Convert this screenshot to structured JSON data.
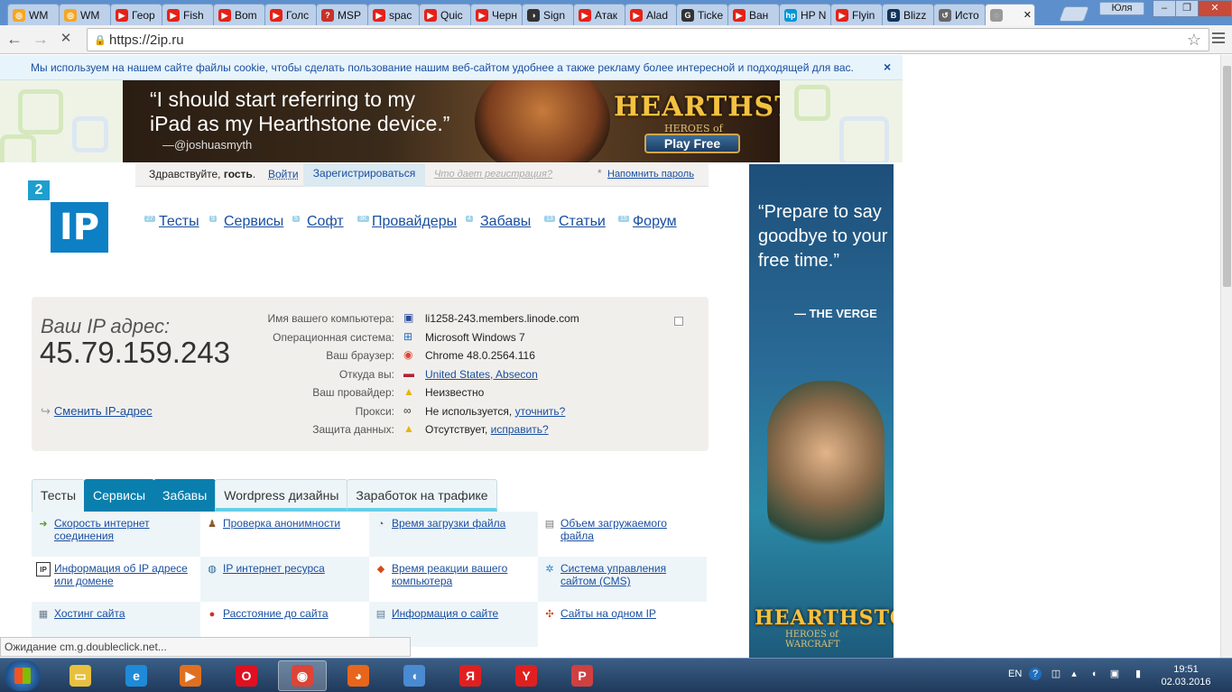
{
  "browser": {
    "tabs": [
      {
        "title": "WM",
        "color": "#f6a623",
        "glyph": "◎"
      },
      {
        "title": "WM",
        "color": "#f6a623",
        "glyph": "◎"
      },
      {
        "title": "Геор",
        "color": "#e62117",
        "glyph": "▶"
      },
      {
        "title": "Fish",
        "color": "#e62117",
        "glyph": "▶"
      },
      {
        "title": "Bom",
        "color": "#e62117",
        "glyph": "▶"
      },
      {
        "title": "Голс",
        "color": "#e62117",
        "glyph": "▶"
      },
      {
        "title": "MSP",
        "color": "#c8302a",
        "glyph": "?"
      },
      {
        "title": "spac",
        "color": "#e62117",
        "glyph": "▶"
      },
      {
        "title": "Quic",
        "color": "#e62117",
        "glyph": "▶"
      },
      {
        "title": "Черн",
        "color": "#e62117",
        "glyph": "▶"
      },
      {
        "title": "Sign",
        "color": "#333333",
        "glyph": "◑"
      },
      {
        "title": "Атак",
        "color": "#e62117",
        "glyph": "▶"
      },
      {
        "title": "Alad",
        "color": "#e62117",
        "glyph": "▶"
      },
      {
        "title": "Ticke",
        "color": "#333333",
        "glyph": "G"
      },
      {
        "title": "Ван",
        "color": "#e62117",
        "glyph": "▶"
      },
      {
        "title": "HP N",
        "color": "#0096d6",
        "glyph": "hp"
      },
      {
        "title": "Flyin",
        "color": "#e62117",
        "glyph": "▶"
      },
      {
        "title": "Blizz",
        "color": "#12345a",
        "glyph": "B"
      },
      {
        "title": "Исто",
        "color": "#666666",
        "glyph": "↺"
      },
      {
        "title": "",
        "color": "#999999",
        "glyph": "◌"
      }
    ],
    "active_tab_close": "✕",
    "user_name": "Юля",
    "window_buttons": {
      "minimize": "–",
      "maximize": "❐",
      "close": "✕"
    },
    "url": "https://2ip.ru",
    "nav": {
      "back": "←",
      "forward": "→",
      "stop": "✕",
      "star": "☆"
    }
  },
  "cookie": {
    "text": "Мы используем на нашем сайте файлы cookie, чтобы сделать пользование нашим веб-сайтом удобнее а также рекламу более интересной и подходящей для вас.",
    "close": "×"
  },
  "banner_top": {
    "quote_line1": "“I should start referring to my",
    "quote_line2": "iPad as my Hearthstone device.”",
    "author": "—@joshuasmyth",
    "logo": "HEARTHSTONE",
    "logo_sub": "HEROES of WARCRAFT",
    "play": "Play Free"
  },
  "login_bar": {
    "greeting": "Здравствуйте, ",
    "guest": "гость",
    "dot": ".",
    "login": "Войти",
    "register": "Зарегистрироваться",
    "what_gives": "Что дает регистрация?",
    "asterisk": "*",
    "remind": "Напомнить пароль"
  },
  "logo": {
    "small": "2",
    "big": "IP"
  },
  "site_nav": [
    {
      "label": "Тесты",
      "count": "27"
    },
    {
      "label": "Сервисы",
      "count": "9"
    },
    {
      "label": "Софт",
      "count": "5"
    },
    {
      "label": "Провайдеры",
      "count": "3K"
    },
    {
      "label": "Забавы",
      "count": "4"
    },
    {
      "label": "Статьи",
      "count": "13"
    },
    {
      "label": "Форум",
      "count": "15"
    }
  ],
  "ip_info": {
    "label": "Ваш IP адрес:",
    "ip": "45.79.159.243",
    "change": "Сменить IP-адрес",
    "rows": [
      {
        "key": "Имя вашего компьютера:",
        "value": "li1258-243.members.linode.com",
        "icon": "computer-icon",
        "glyph": "▣",
        "color": "#2a4a9a"
      },
      {
        "key": "Операционная система:",
        "value": "Microsoft Windows 7",
        "icon": "windows-icon",
        "glyph": "⊞",
        "color": "#1f6fbf"
      },
      {
        "key": "Ваш браузер:",
        "value": "Chrome 48.0.2564.116",
        "icon": "chrome-icon",
        "glyph": "◉",
        "color": "#db4437"
      },
      {
        "key": "Откуда вы:",
        "link": "United States, Absecon",
        "icon": "us-flag-icon",
        "glyph": "▬",
        "color": "#b22234"
      },
      {
        "key": "Ваш провайдер:",
        "value": "Неизвестно",
        "icon": "warning-icon",
        "glyph": "▲",
        "color": "#e8b400"
      },
      {
        "key": "Прокси:",
        "value": "Не используется, ",
        "link": "уточнить?",
        "icon": "glasses-icon",
        "glyph": "∞",
        "color": "#333333"
      },
      {
        "key": "Защита данных:",
        "value": "Отсутствует, ",
        "link": "исправить?",
        "icon": "warning-icon",
        "glyph": "▲",
        "color": "#e8b400"
      }
    ]
  },
  "service_tabs": [
    {
      "label": "Тесты",
      "active": false,
      "underline": false
    },
    {
      "label": "Сервисы",
      "active": true,
      "underline": false
    },
    {
      "label": "Забавы",
      "active": true,
      "underline": false
    },
    {
      "label": "Wordpress дизайны",
      "active": false,
      "underline": true
    },
    {
      "label": "Заработок на трафике",
      "active": false,
      "underline": true
    }
  ],
  "services": [
    {
      "label": "Скорость интернет соединения",
      "icon": "speed-icon",
      "glyph": "➜",
      "color": "#5aa02c"
    },
    {
      "label": "Проверка анонимности",
      "icon": "spy-icon",
      "glyph": "♟",
      "color": "#8a5a2a"
    },
    {
      "label": "Время загрузки файла",
      "icon": "clock-icon",
      "glyph": "◔",
      "color": "#555555"
    },
    {
      "label": "Объем загружаемого файла",
      "icon": "monitor-icon",
      "glyph": "▤",
      "color": "#777777"
    },
    {
      "label": "Информация об IP адресе или домене",
      "icon": "ip-icon",
      "glyph": "IP",
      "color": "#333333"
    },
    {
      "label": "IP интернет ресурса",
      "icon": "ip-globe-icon",
      "glyph": "◍",
      "color": "#2a6a9a"
    },
    {
      "label": "Время реакции вашего компьютера",
      "icon": "reaction-icon",
      "glyph": "◆",
      "color": "#d64a1a"
    },
    {
      "label": "Система управления сайтом (CMS)",
      "icon": "cms-icon",
      "glyph": "✲",
      "color": "#2a8ad0"
    },
    {
      "label": "Хостинг сайта",
      "icon": "hosting-icon",
      "glyph": "▦",
      "color": "#6a7a8a"
    },
    {
      "label": "Расстояние до сайта",
      "icon": "pin-icon",
      "glyph": "●",
      "color": "#d03020"
    },
    {
      "label": "Информация о сайте",
      "icon": "info-icon",
      "glyph": "▤",
      "color": "#5a7a9a"
    },
    {
      "label": "Сайты на одном IP",
      "icon": "sites-icon",
      "glyph": "✣",
      "color": "#d04020"
    }
  ],
  "ad_right": {
    "quote": "“Prepare to say goodbye to your free time.”",
    "source": "— THE VERGE",
    "logo": "HEARTHSTONE",
    "logo_sub": "HEROES of WARCRAFT"
  },
  "status": "Ожидание cm.g.doubleclick.net...",
  "taskbar": {
    "apps": [
      {
        "name": "explorer",
        "glyph": "▭",
        "color": "#e8c040",
        "active": false
      },
      {
        "name": "ie",
        "glyph": "e",
        "color": "#1f8ad8",
        "active": false
      },
      {
        "name": "media",
        "glyph": "▶",
        "color": "#e07020",
        "active": false
      },
      {
        "name": "opera",
        "glyph": "O",
        "color": "#e01020",
        "active": false
      },
      {
        "name": "chrome",
        "glyph": "◉",
        "color": "#db4437",
        "active": true
      },
      {
        "name": "firefox",
        "glyph": "◕",
        "color": "#e8661a",
        "active": false
      },
      {
        "name": "volume",
        "glyph": "◖",
        "color": "#4a8ad0",
        "active": false
      },
      {
        "name": "yandex",
        "glyph": "Я",
        "color": "#e02020",
        "active": false
      },
      {
        "name": "yandex-browser",
        "glyph": "Y",
        "color": "#e02020",
        "active": false
      },
      {
        "name": "periscope",
        "glyph": "P",
        "color": "#d04040",
        "active": false
      }
    ],
    "lang": "EN",
    "time": "19:51",
    "date": "02.03.2016"
  }
}
